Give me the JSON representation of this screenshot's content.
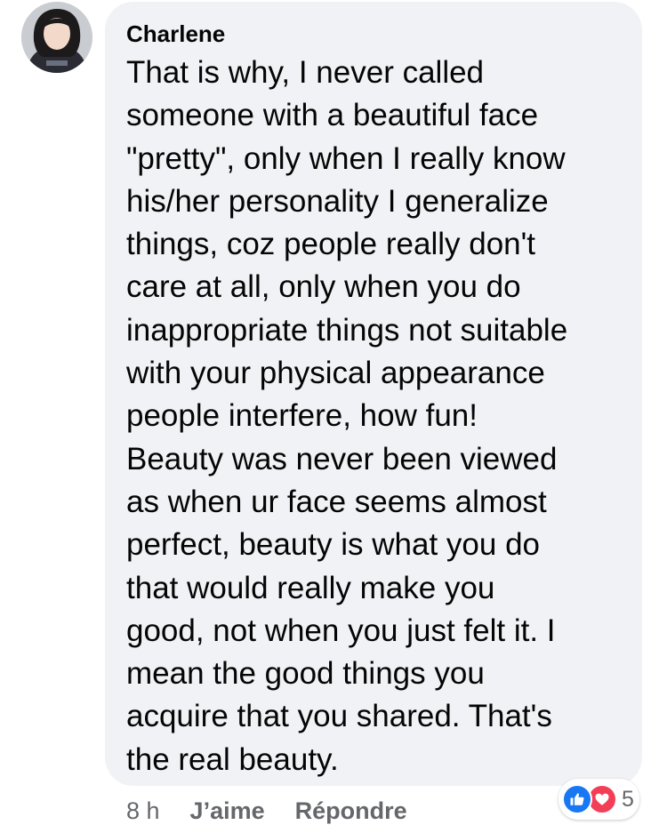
{
  "comment": {
    "author": "Charlene",
    "text": "That is why, I never called\nsomeone with a beautiful face\n\"pretty\", only when I really know\nhis/her personality I generalize\nthings, coz people really don't\ncare at all, only when you do\ninappropriate things not suitable\nwith your physical appearance\npeople interfere, how fun!\nBeauty was never been viewed\nas when ur face seems almost\nperfect, beauty is what you do\nthat would really make you\ngood, not when you just felt it. I\nmean the good things you\nacquire that you shared. That's\nthe real beauty.",
    "timestamp": "8 h",
    "like_label": "J’aime",
    "reply_label": "Répondre",
    "reactions": {
      "icons": [
        "like-icon",
        "love-icon"
      ],
      "count": "5"
    }
  },
  "colors": {
    "bubble_background": "#f0f2f5",
    "text": "#050505",
    "secondary_text": "#65676b",
    "like_blue": "#1877f2",
    "love_red": "#f33e58"
  }
}
